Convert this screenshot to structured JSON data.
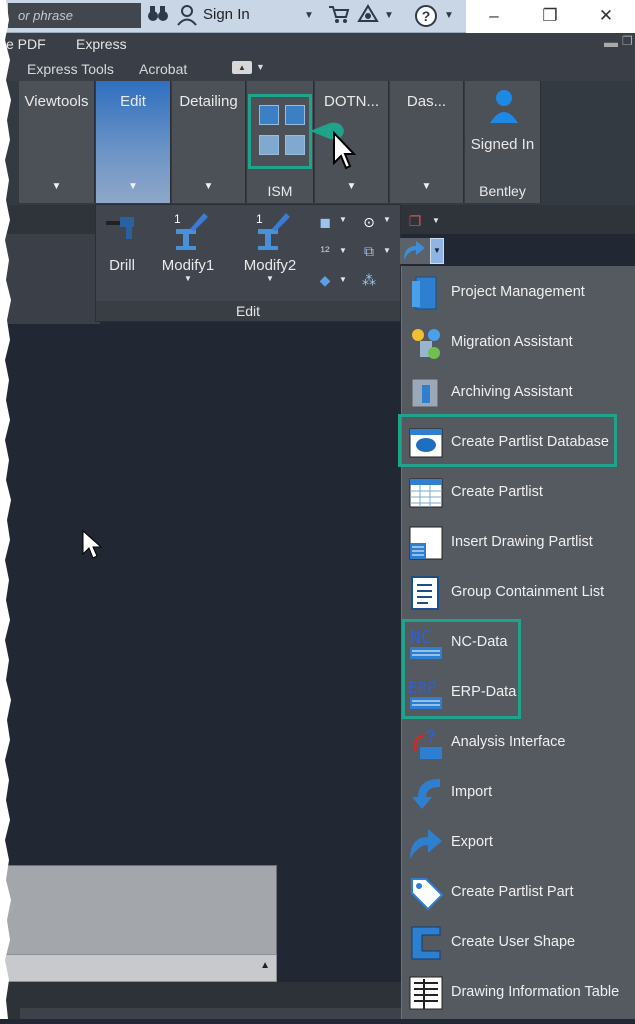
{
  "titlebar": {
    "search_placeholder": "or phrase",
    "sign_in": "Sign In",
    "icons": [
      "binoculars-icon",
      "user-icon",
      "cart-icon",
      "exchange-icon",
      "help-icon"
    ],
    "window_buttons": [
      "–",
      "❐",
      "✕"
    ]
  },
  "menubar": {
    "items": [
      "e PDF",
      "Express"
    ]
  },
  "tabbar": {
    "items": [
      "Express Tools",
      "Acrobat"
    ]
  },
  "ribbon": {
    "tabs": [
      "Viewtools",
      "Edit",
      "Detailing",
      "ISM",
      "DOTN...",
      "Das...",
      "Signed In"
    ],
    "ism_label": "ISM",
    "bentley_label": "Bentley",
    "signed_in_label": "Signed In"
  },
  "edit_panel": {
    "title": "Edit",
    "buttons": [
      "Drill",
      "Modify1",
      "Modify2"
    ]
  },
  "dropdown": {
    "items": [
      {
        "label": "Project Management",
        "icon": "folder-book-icon",
        "highlight": false
      },
      {
        "label": "Migration Assistant",
        "icon": "migration-icon",
        "highlight": false
      },
      {
        "label": "Archiving Assistant",
        "icon": "archive-icon",
        "highlight": false
      },
      {
        "label": "Create Partlist Database",
        "icon": "database-icon",
        "highlight": true
      },
      {
        "label": "Create Partlist",
        "icon": "grid-icon",
        "highlight": false
      },
      {
        "label": "Insert Drawing Partlist",
        "icon": "drawing-table-icon",
        "highlight": false
      },
      {
        "label": "Group Containment List",
        "icon": "list-icon",
        "highlight": false
      },
      {
        "label": "NC-Data",
        "icon": "nc-icon",
        "highlight": true
      },
      {
        "label": "ERP-Data",
        "icon": "erp-icon",
        "highlight": true
      },
      {
        "label": "Analysis Interface",
        "icon": "analysis-icon",
        "highlight": false
      },
      {
        "label": "Import",
        "icon": "import-arrow-icon",
        "highlight": false
      },
      {
        "label": "Export",
        "icon": "export-arrow-icon",
        "highlight": false
      },
      {
        "label": "Create Partlist Part",
        "icon": "tag-icon",
        "highlight": false
      },
      {
        "label": "Create User Shape",
        "icon": "c-shape-icon",
        "highlight": false
      },
      {
        "label": "Drawing Information Table",
        "icon": "info-table-icon",
        "highlight": false
      }
    ]
  },
  "colors": {
    "highlight": "#1fa38a",
    "accent": "#2f6fbf"
  }
}
